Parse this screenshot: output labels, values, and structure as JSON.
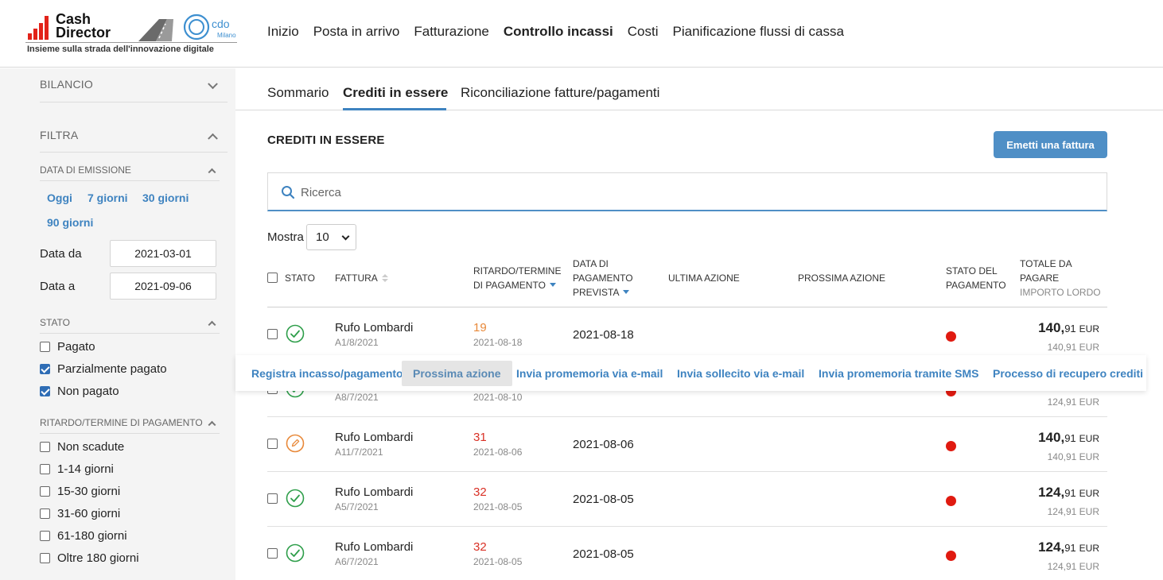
{
  "brand": {
    "name_line1": "Cash",
    "name_line2": "Director",
    "partner": "cdo",
    "partner_city": "Milano",
    "tagline": "Insieme sulla strada dell'innovazione digitale"
  },
  "main_nav": [
    {
      "label": "Inizio",
      "active": false
    },
    {
      "label": "Posta in arrivo",
      "active": false
    },
    {
      "label": "Fatturazione",
      "active": false
    },
    {
      "label": "Controllo incassi",
      "active": true
    },
    {
      "label": "Costi",
      "active": false
    },
    {
      "label": "Pianificazione flussi di cassa",
      "active": false
    }
  ],
  "sidebar": {
    "balance_label": "BILANCIO",
    "filter_label": "FILTRA",
    "issue_date": {
      "label": "DATA DI EMISSIONE",
      "quick": [
        "Oggi",
        "7 giorni",
        "30 giorni",
        "90 giorni"
      ],
      "from_label": "Data da",
      "from_value": "2021-03-01",
      "to_label": "Data a",
      "to_value": "2021-09-06"
    },
    "state": {
      "label": "STATO",
      "options": [
        {
          "label": "Pagato",
          "checked": false
        },
        {
          "label": "Parzialmente pagato",
          "checked": true
        },
        {
          "label": "Non pagato",
          "checked": true
        }
      ]
    },
    "delay": {
      "label": "RITARDO/TERMINE DI PAGAMENTO",
      "options": [
        {
          "label": "Non scadute",
          "checked": false
        },
        {
          "label": "1-14 giorni",
          "checked": false
        },
        {
          "label": "15-30 giorni",
          "checked": false
        },
        {
          "label": "31-60 giorni",
          "checked": false
        },
        {
          "label": "61-180 giorni",
          "checked": false
        },
        {
          "label": "Oltre 180 giorni",
          "checked": false
        }
      ]
    }
  },
  "sub_tabs": [
    {
      "label": "Sommario",
      "active": false
    },
    {
      "label": "Crediti in essere",
      "active": true
    },
    {
      "label": "Riconciliazione fatture/pagamenti",
      "active": false
    }
  ],
  "content": {
    "title": "CREDITI IN ESSERE",
    "primary_button": "Emetti una fattura",
    "search_placeholder": "Ricerca",
    "show_label": "Mostra",
    "show_value": "10"
  },
  "table": {
    "headers": {
      "state": "STATO",
      "invoice": "FATTURA",
      "delay_line1": "RITARDO/TERMINE",
      "delay_line2": "DI PAGAMENTO",
      "expected_line1": "DATA DI",
      "expected_line2": "PAGAMENTO",
      "expected_line3": "PREVISTA",
      "last_action": "ULTIMA AZIONE",
      "next_action": "PROSSIMA AZIONE",
      "pay_state_line1": "STATO DEL",
      "pay_state_line2": "PAGAMENTO",
      "total_line1": "TOTALE DA",
      "total_line2": "PAGARE",
      "total_sub": "IMPORTO LORDO"
    },
    "rows": [
      {
        "status_icon": "check-circle-icon",
        "name": "Rufo Lombardi",
        "number": "A1/8/2021",
        "delay": "19",
        "delay_color": "#e8893a",
        "deadline": "2021-08-18",
        "expected": "2021-08-18",
        "total_int": "140,",
        "total_cents": "91",
        "currency": "EUR",
        "gross": "140,91 EUR"
      },
      {
        "status_icon": "check-circle-icon",
        "name": "",
        "number": "A8/7/2021",
        "delay": "",
        "delay_color": "#d93025",
        "deadline": "2021-08-10",
        "expected": "",
        "total_int": "",
        "total_cents": "",
        "currency": "",
        "gross": "124,91 EUR"
      },
      {
        "status_icon": "pencil-circle-icon",
        "name": "Rufo Lombardi",
        "number": "A11/7/2021",
        "delay": "31",
        "delay_color": "#d93025",
        "deadline": "2021-08-06",
        "expected": "2021-08-06",
        "total_int": "140,",
        "total_cents": "91",
        "currency": "EUR",
        "gross": "140,91 EUR"
      },
      {
        "status_icon": "check-circle-icon",
        "name": "Rufo Lombardi",
        "number": "A5/7/2021",
        "delay": "32",
        "delay_color": "#d93025",
        "deadline": "2021-08-05",
        "expected": "2021-08-05",
        "total_int": "124,",
        "total_cents": "91",
        "currency": "EUR",
        "gross": "124,91 EUR"
      },
      {
        "status_icon": "check-circle-icon",
        "name": "Rufo Lombardi",
        "number": "A6/7/2021",
        "delay": "32",
        "delay_color": "#d93025",
        "deadline": "2021-08-05",
        "expected": "2021-08-05",
        "total_int": "124,",
        "total_cents": "91",
        "currency": "EUR",
        "gross": "124,91 EUR"
      }
    ]
  },
  "row_actions": [
    {
      "label": "Registra incasso/pagamento",
      "active": false
    },
    {
      "label": "Prossima azione",
      "active": true
    },
    {
      "label": "Invia promemoria via e-mail",
      "active": false
    },
    {
      "label": "Invia sollecito via e-mail",
      "active": false
    },
    {
      "label": "Invia promemoria tramite SMS",
      "active": false
    },
    {
      "label": "Processo di recupero crediti",
      "active": false
    }
  ],
  "colors": {
    "accent": "#3e83c0",
    "button": "#4f8fc6",
    "unpaid_dot": "#e01a10",
    "paid_icon": "#2e9e4a",
    "partial_icon": "#e8893a"
  }
}
